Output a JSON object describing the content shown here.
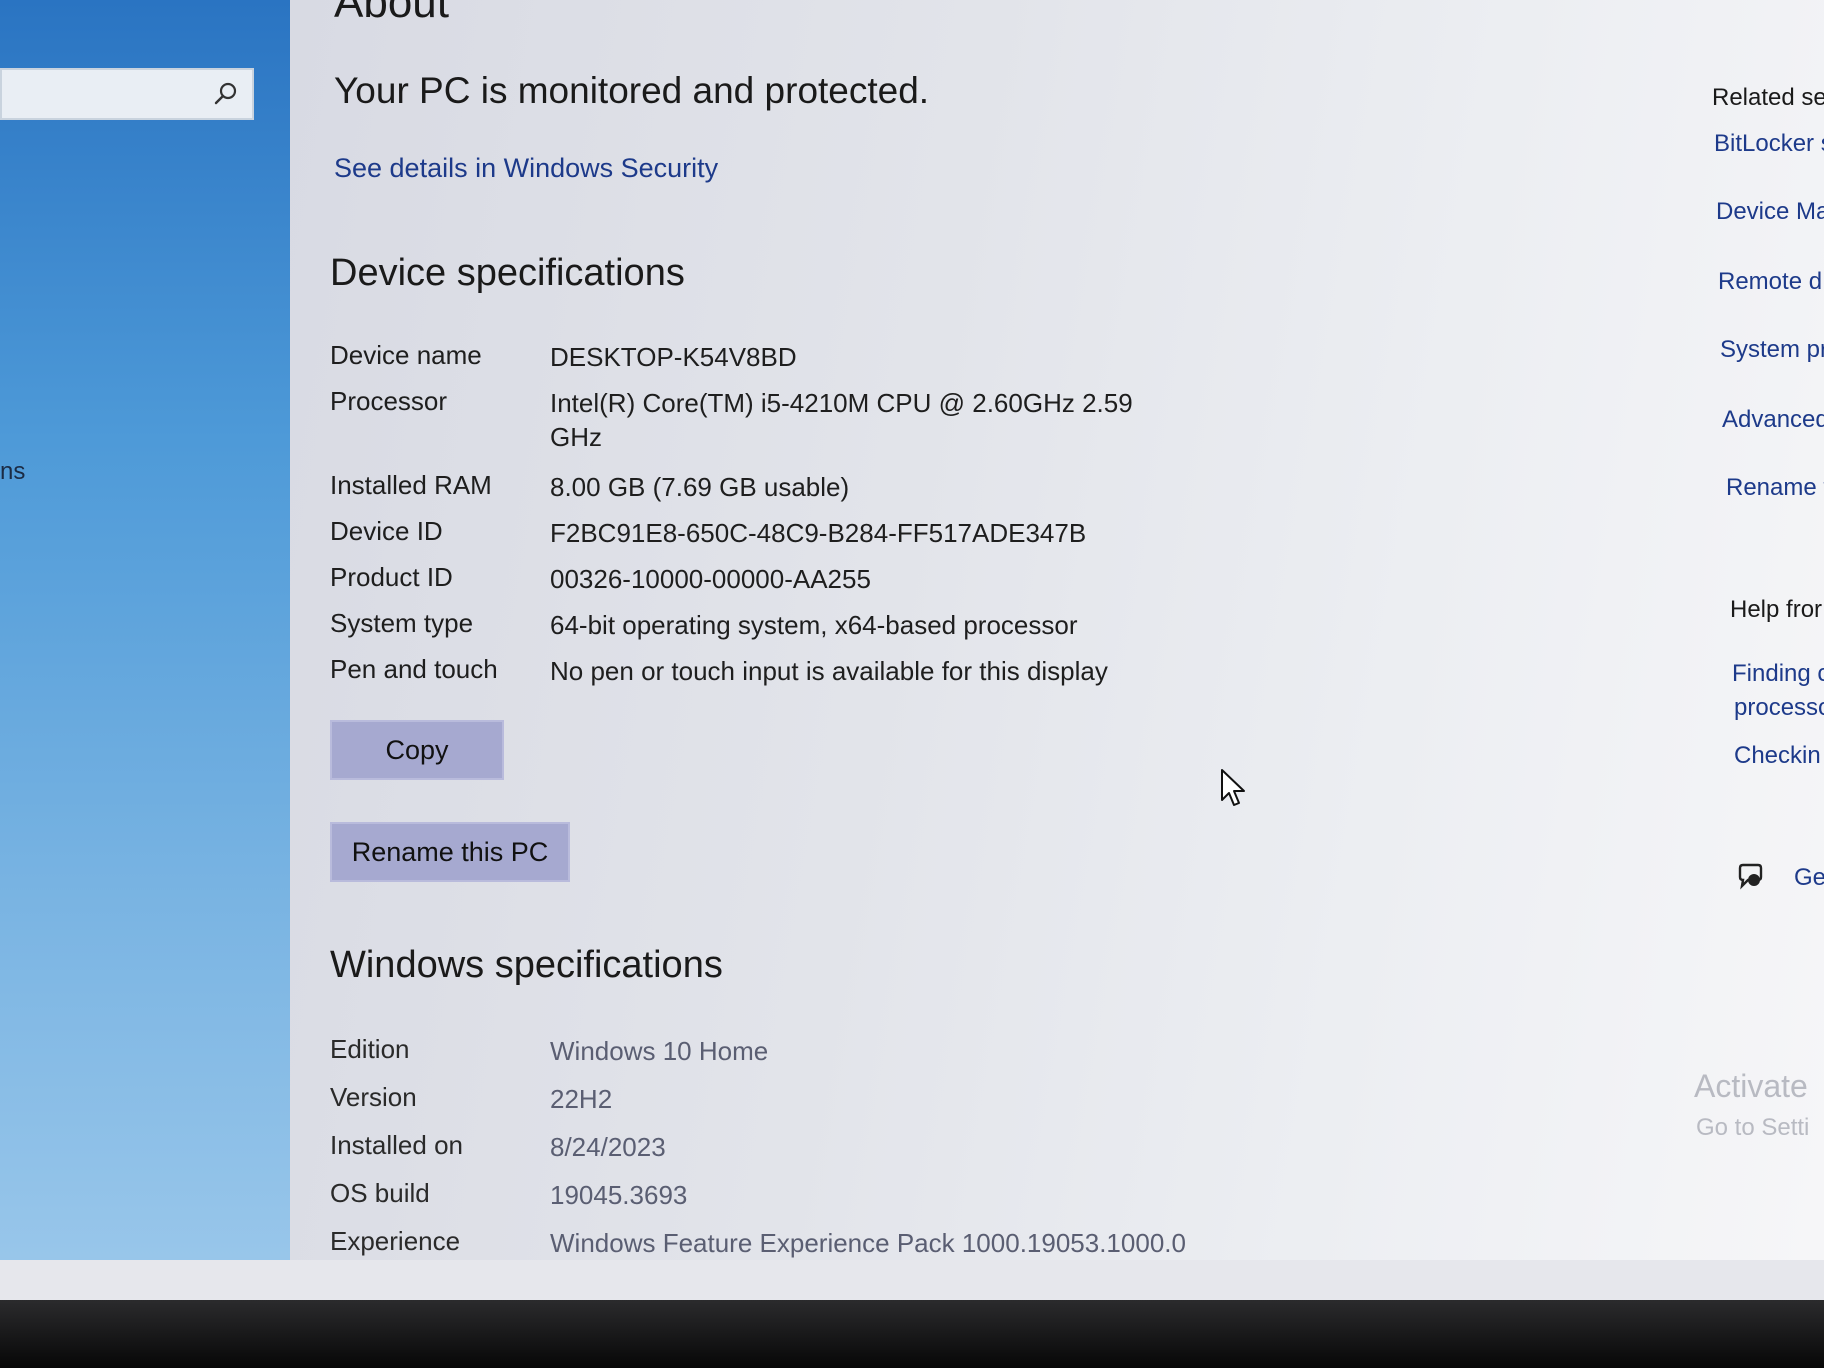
{
  "page_title": "About",
  "protection": {
    "message": "Your PC is monitored and protected.",
    "link": "See details in Windows Security"
  },
  "nav": {
    "partial_item": "ns"
  },
  "device_specs": {
    "heading": "Device specifications",
    "rows": [
      {
        "label": "Device name",
        "value": "DESKTOP-K54V8BD"
      },
      {
        "label": "Processor",
        "value": "Intel(R) Core(TM) i5-4210M CPU @ 2.60GHz   2.59 GHz"
      },
      {
        "label": "Installed RAM",
        "value": "8.00 GB (7.69 GB usable)"
      },
      {
        "label": "Device ID",
        "value": "F2BC91E8-650C-48C9-B284-FF517ADE347B"
      },
      {
        "label": "Product ID",
        "value": "00326-10000-00000-AA255"
      },
      {
        "label": "System type",
        "value": "64-bit operating system, x64-based processor"
      },
      {
        "label": "Pen and touch",
        "value": "No pen or touch input is available for this display"
      }
    ],
    "copy_button": "Copy",
    "rename_button": "Rename this PC"
  },
  "windows_specs": {
    "heading": "Windows specifications",
    "rows": [
      {
        "label": "Edition",
        "value": "Windows 10 Home"
      },
      {
        "label": "Version",
        "value": "22H2"
      },
      {
        "label": "Installed on",
        "value": "8/24/2023"
      },
      {
        "label": "OS build",
        "value": "19045.3693"
      },
      {
        "label": "Experience",
        "value": "Windows Feature Experience Pack 1000.19053.1000.0"
      }
    ]
  },
  "related": {
    "heading": "Related set",
    "items": [
      "BitLocker s",
      "Device Ma",
      "Remote d",
      "System pr",
      "Advanced",
      "Rename t"
    ],
    "help_heading": "Help fror",
    "help_items": [
      "Finding c",
      "processo",
      "Checkin"
    ],
    "feedback": "Ge"
  },
  "watermark": {
    "line1": "Activate",
    "line2": "Go to Setti"
  },
  "icons": {
    "search": "search-icon",
    "cursor": "mouse-cursor-icon",
    "feedback": "feedback-icon"
  }
}
